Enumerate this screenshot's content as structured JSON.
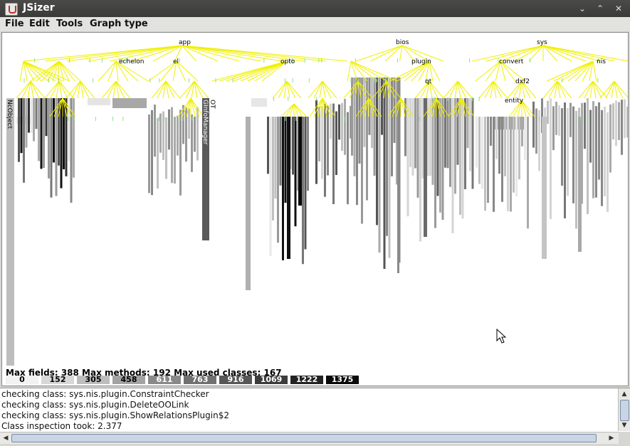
{
  "window": {
    "title": "JSizer"
  },
  "menu": [
    "File",
    "Edit",
    "Tools",
    "Graph type"
  ],
  "graph": {
    "nodes": [
      "app",
      "bios",
      "sys",
      "echelon",
      "el",
      "opto",
      "plugin",
      "convert",
      "nis",
      "qt",
      "dxf2",
      "entity"
    ],
    "vertical_labels": [
      "NcObject",
      "OT",
      "GInfoManager"
    ]
  },
  "stats": {
    "text": "Max fields: 388  Max methods: 192  Max used classes: 167"
  },
  "legend": {
    "values": [
      "0",
      "152",
      "305",
      "458",
      "611",
      "763",
      "916",
      "1069",
      "1222",
      "1375"
    ],
    "colors": [
      "#f2f2f2",
      "#d8d8d8",
      "#bdbdbd",
      "#a3a3a3",
      "#898989",
      "#707070",
      "#575757",
      "#3c3c3c",
      "#232323",
      "#0a0a0a"
    ]
  },
  "console": {
    "lines": [
      "checking class: sys.nis.plugin.ConstraintChecker",
      "checking class: sys.nis.plugin.DeleteOOLink",
      "checking class: sys.nis.plugin.ShowRelationsPlugin$2",
      "Class inspection took: 2.377"
    ]
  }
}
